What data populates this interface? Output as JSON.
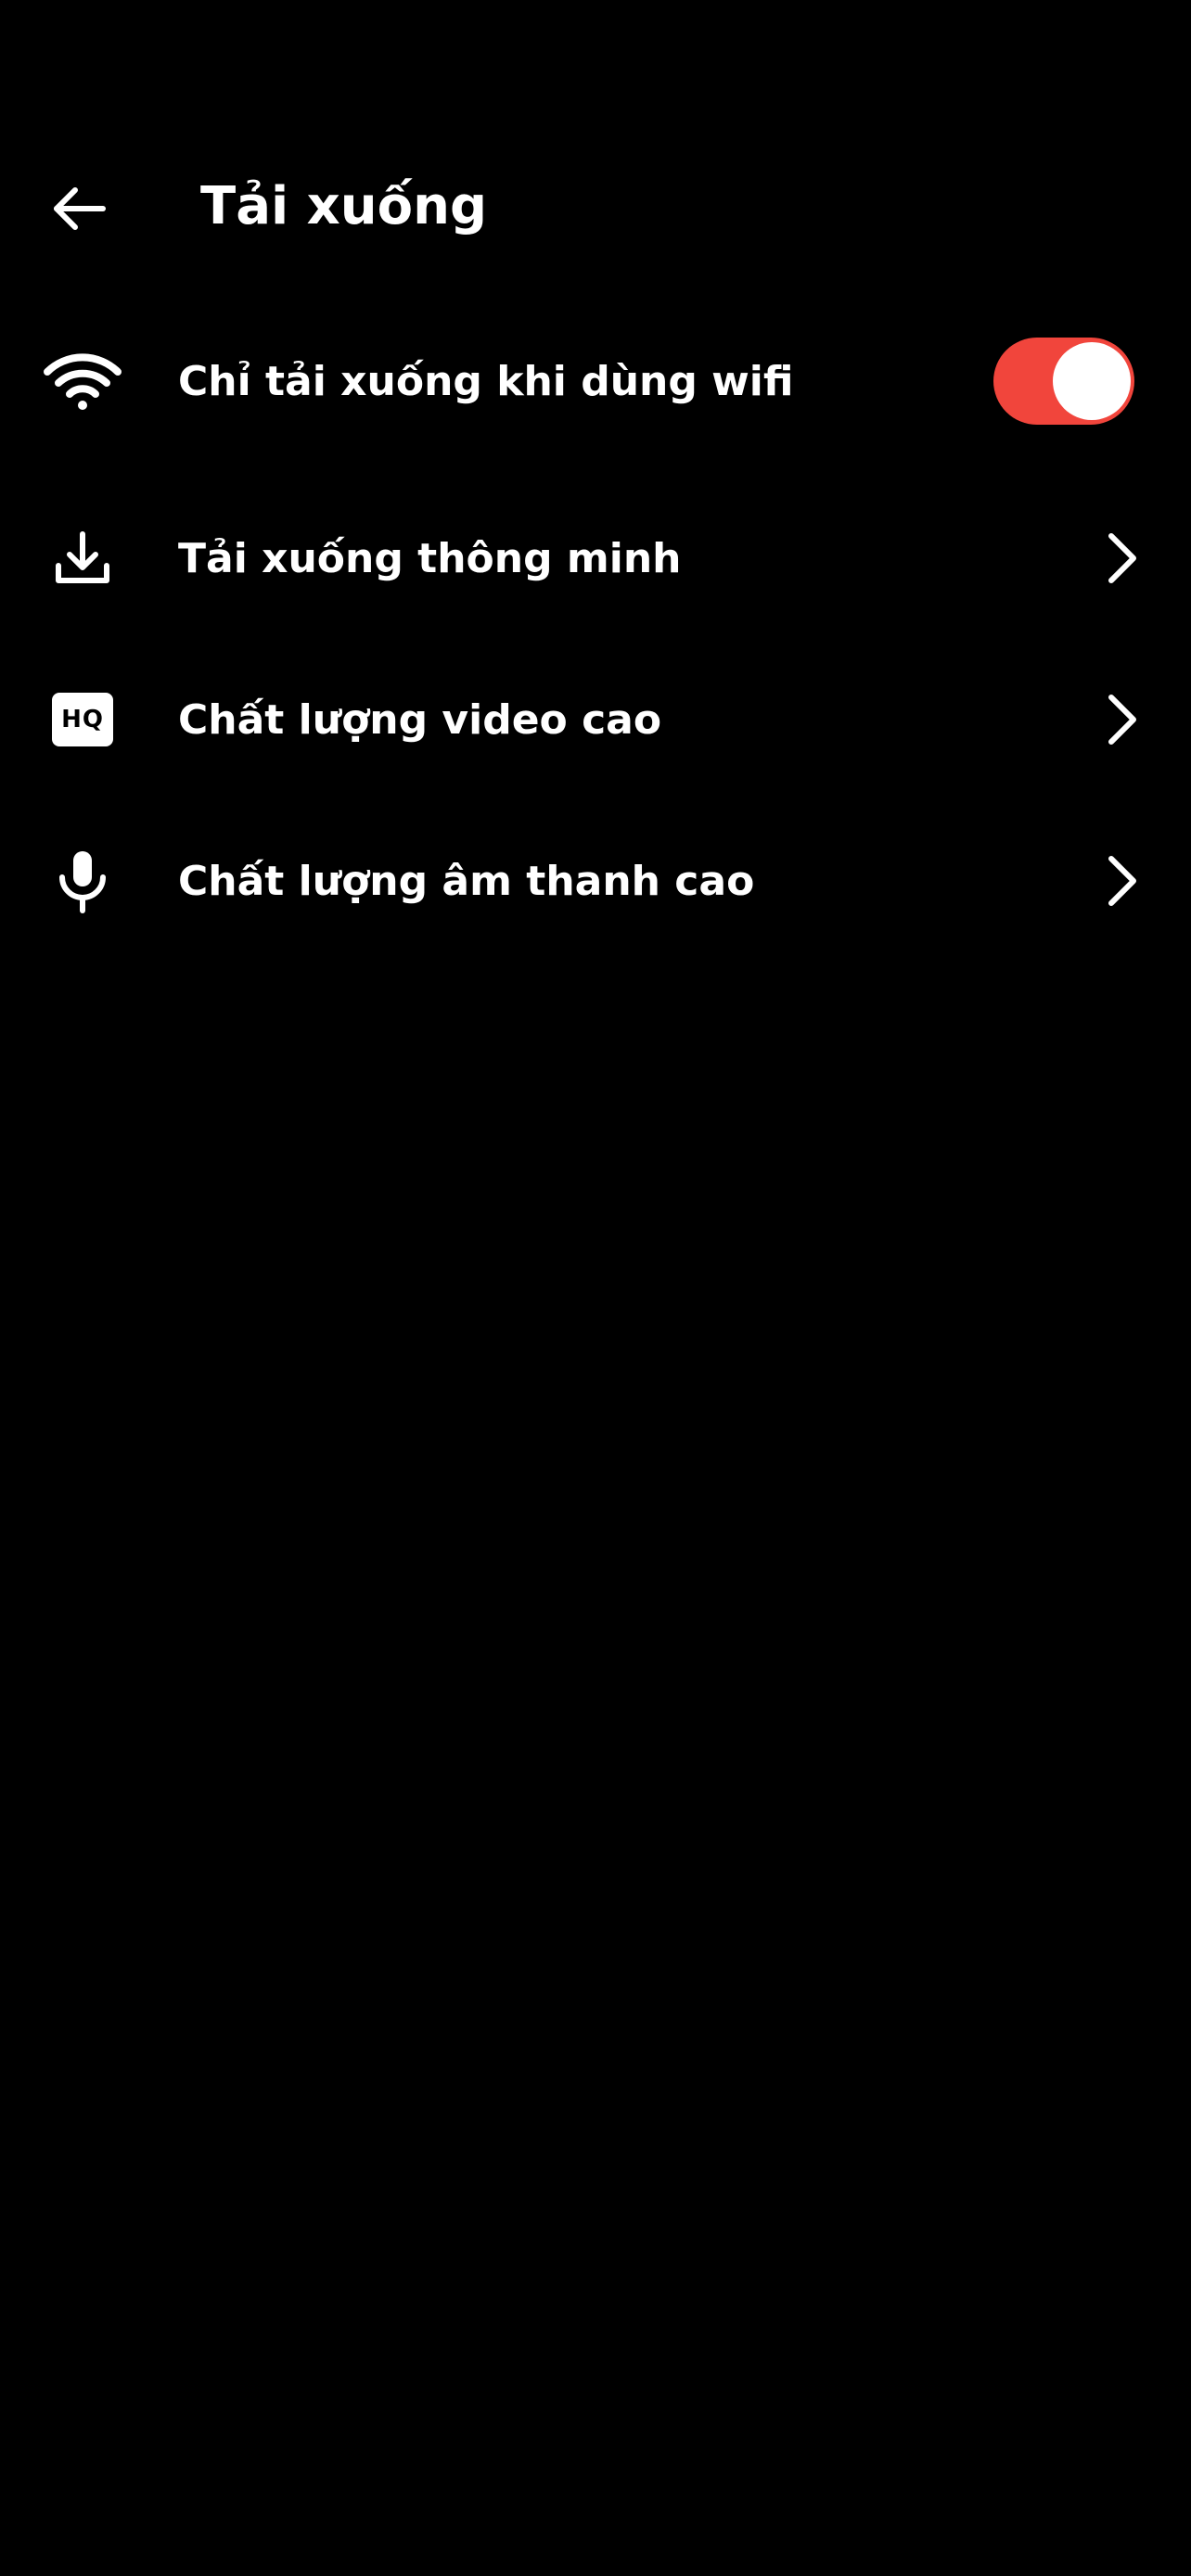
{
  "header": {
    "title": "Tải xuống",
    "back_icon": "arrow-left-icon"
  },
  "settings": {
    "wifi_only": {
      "label": "Chỉ tải xuống khi dùng wifi",
      "icon": "wifi-icon",
      "toggle_on": true,
      "toggle_color": "#f1453c"
    },
    "items": [
      {
        "label": "Tải xuống thông minh",
        "icon": "download-icon"
      },
      {
        "label": "Chất lượng video cao",
        "icon": "hq-icon",
        "badge_text": "HQ"
      },
      {
        "label": "Chất lượng âm thanh cao",
        "icon": "microphone-icon"
      }
    ]
  },
  "colors": {
    "background": "#000000",
    "text": "#ffffff",
    "accent": "#f1453c"
  }
}
